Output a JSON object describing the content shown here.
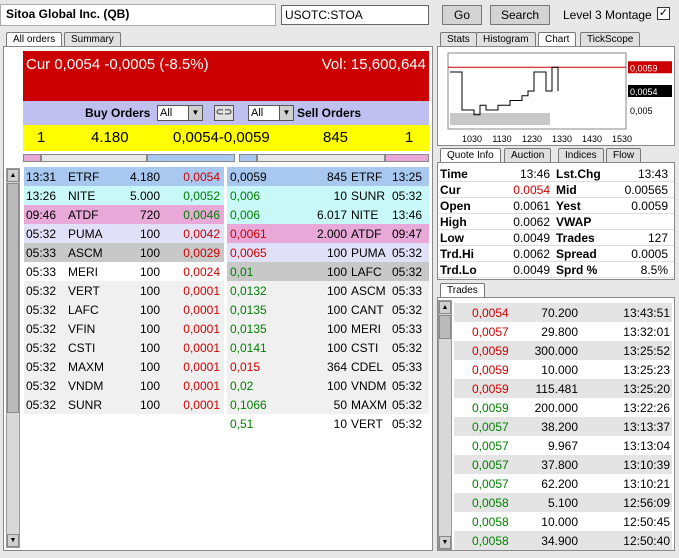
{
  "header": {
    "company": "Sitoa Global Inc. (QB)",
    "symbol": "USOTC:STOA",
    "go_label": "Go",
    "search_label": "Search",
    "level3_label": "Level 3 Montage",
    "level3_checked": "✓"
  },
  "left_tabs": [
    "All orders",
    "Summary"
  ],
  "right_tabs": [
    "Stats",
    "Histogram",
    "Chart",
    "TickScope"
  ],
  "quote_tabs": [
    "Quote Info",
    "Auction",
    "Indices",
    "Flow"
  ],
  "trades_tab": "Trades",
  "banner": {
    "cur": "Cur 0,0054 -0,0005 (-8.5%)",
    "vol": "Vol: 15,600,644"
  },
  "orders_header": {
    "buy_label": "Buy Orders",
    "sell_label": "Sell Orders",
    "buy_filter": "All",
    "sell_filter": "All"
  },
  "best": {
    "bid_count": "1",
    "bid_size": "4.180",
    "spread": "0,0054-0,0059",
    "ask_size": "845",
    "ask_count": "1"
  },
  "buy_orders": [
    {
      "time": "13:31",
      "mm": "ETRF",
      "size": "4.180",
      "price": "0,0054",
      "pc": "red",
      "bg": "#a8c8f0"
    },
    {
      "time": "13:26",
      "mm": "NITE",
      "size": "5.000",
      "price": "0,0052",
      "pc": "grn",
      "bg": "#c8f8f8"
    },
    {
      "time": "09:46",
      "mm": "ATDF",
      "size": "720",
      "price": "0,0046",
      "pc": "grn",
      "bg": "#e8a8d8"
    },
    {
      "time": "05:32",
      "mm": "PUMA",
      "size": "100",
      "price": "0,0042",
      "pc": "red",
      "bg": "#e0e0f8"
    },
    {
      "time": "05:33",
      "mm": "ASCM",
      "size": "100",
      "price": "0,0029",
      "pc": "red",
      "bg": "#c8c8c8"
    },
    {
      "time": "05:33",
      "mm": "MERI",
      "size": "100",
      "price": "0,0024",
      "pc": "red",
      "bg": "#ffffff"
    },
    {
      "time": "05:32",
      "mm": "VERT",
      "size": "100",
      "price": "0,0001",
      "pc": "red",
      "bg": "#f0f0f0"
    },
    {
      "time": "05:32",
      "mm": "LAFC",
      "size": "100",
      "price": "0,0001",
      "pc": "red",
      "bg": "#f0f0f0"
    },
    {
      "time": "05:32",
      "mm": "VFIN",
      "size": "100",
      "price": "0,0001",
      "pc": "red",
      "bg": "#f0f0f0"
    },
    {
      "time": "05:32",
      "mm": "CSTI",
      "size": "100",
      "price": "0,0001",
      "pc": "red",
      "bg": "#f0f0f0"
    },
    {
      "time": "05:32",
      "mm": "MAXM",
      "size": "100",
      "price": "0,0001",
      "pc": "red",
      "bg": "#f0f0f0"
    },
    {
      "time": "05:32",
      "mm": "VNDM",
      "size": "100",
      "price": "0,0001",
      "pc": "red",
      "bg": "#f0f0f0"
    },
    {
      "time": "05:32",
      "mm": "SUNR",
      "size": "100",
      "price": "0,0001",
      "pc": "red",
      "bg": "#f0f0f0"
    }
  ],
  "sell_orders": [
    {
      "price": "0,0059",
      "size": "845",
      "mm": "ETRF",
      "time": "13:25",
      "pc": "blk",
      "bg": "#a8c8f0"
    },
    {
      "price": "0,006",
      "size": "10",
      "mm": "SUNR",
      "time": "05:32",
      "pc": "grn",
      "bg": "#c8f8f8"
    },
    {
      "price": "0,006",
      "size": "6.017",
      "mm": "NITE",
      "time": "13:46",
      "pc": "grn",
      "bg": "#c8f8f8"
    },
    {
      "price": "0,0061",
      "size": "2.000",
      "mm": "ATDF",
      "time": "09:47",
      "pc": "red",
      "bg": "#e8a8d8"
    },
    {
      "price": "0,0065",
      "size": "100",
      "mm": "PUMA",
      "time": "05:32",
      "pc": "red",
      "bg": "#e0e0f8"
    },
    {
      "price": "0,01",
      "size": "100",
      "mm": "LAFC",
      "time": "05:32",
      "pc": "grn",
      "bg": "#c8c8c8"
    },
    {
      "price": "0,0132",
      "size": "100",
      "mm": "ASCM",
      "time": "05:33",
      "pc": "grn",
      "bg": "#f0f0f0"
    },
    {
      "price": "0,0135",
      "size": "100",
      "mm": "CANT",
      "time": "05:32",
      "pc": "grn",
      "bg": "#f0f0f0"
    },
    {
      "price": "0,0135",
      "size": "100",
      "mm": "MERI",
      "time": "05:33",
      "pc": "grn",
      "bg": "#f0f0f0"
    },
    {
      "price": "0,0141",
      "size": "100",
      "mm": "CSTI",
      "time": "05:32",
      "pc": "grn",
      "bg": "#f0f0f0"
    },
    {
      "price": "0,015",
      "size": "364",
      "mm": "CDEL",
      "time": "05:33",
      "pc": "red",
      "bg": "#f0f0f0"
    },
    {
      "price": "0,02",
      "size": "100",
      "mm": "VNDM",
      "time": "05:32",
      "pc": "grn",
      "bg": "#f0f0f0"
    },
    {
      "price": "0,1066",
      "size": "50",
      "mm": "MAXM",
      "time": "05:32",
      "pc": "grn",
      "bg": "#f0f0f0"
    },
    {
      "price": "0,51",
      "size": "10",
      "mm": "VERT",
      "time": "05:32",
      "pc": "grn",
      "bg": "#ffffff"
    }
  ],
  "chart": {
    "x_ticks": [
      "1030",
      "1130",
      "1230",
      "1330",
      "1430",
      "1530"
    ],
    "y_labels": [
      "0,0059",
      "0,0054",
      "0,005"
    ],
    "prices": [
      0.0058,
      0.0058,
      0.005,
      0.005,
      0.0049,
      0.0051,
      0.005,
      0.005,
      0.0051,
      0.0051,
      0.0052,
      0.0052,
      0.0053,
      0.0054,
      0.0058,
      0.0058,
      0.0054,
      0.0059,
      0.0054
    ],
    "colors": {
      "last": "#cc0000",
      "current": "#000000"
    }
  },
  "quote": [
    {
      "l1": "Time",
      "v1": "13:46",
      "l2": "Lst.Chg",
      "v2": "13:43",
      "c1": ""
    },
    {
      "l1": "Cur",
      "v1": "0.0054",
      "l2": "Mid",
      "v2": "0.00565",
      "c1": "red"
    },
    {
      "l1": "Open",
      "v1": "0.0061",
      "l2": "Yest",
      "v2": "0.0059",
      "c1": ""
    },
    {
      "l1": "High",
      "v1": "0.0062",
      "l2": "VWAP",
      "v2": "",
      "c1": ""
    },
    {
      "l1": "Low",
      "v1": "0.0049",
      "l2": "Trades",
      "v2": "127",
      "c1": ""
    },
    {
      "l1": "Trd.Hi",
      "v1": "0.0062",
      "l2": "Spread",
      "v2": "0.0005",
      "c1": ""
    },
    {
      "l1": "Trd.Lo",
      "v1": "0.0049",
      "l2": "Sprd %",
      "v2": "8.5%",
      "c1": ""
    }
  ],
  "trades": [
    {
      "price": "0,0054",
      "size": "70.200",
      "time": "13:43:51",
      "pc": "red"
    },
    {
      "price": "0,0057",
      "size": "29.800",
      "time": "13:32:01",
      "pc": "red"
    },
    {
      "price": "0,0059",
      "size": "300.000",
      "time": "13:25:52",
      "pc": "red"
    },
    {
      "price": "0,0059",
      "size": "10.000",
      "time": "13:25:23",
      "pc": "red"
    },
    {
      "price": "0,0059",
      "size": "115.481",
      "time": "13:25:20",
      "pc": "red"
    },
    {
      "price": "0,0059",
      "size": "200.000",
      "time": "13:22:26",
      "pc": "grn"
    },
    {
      "price": "0,0057",
      "size": "38.200",
      "time": "13:13:37",
      "pc": "grn"
    },
    {
      "price": "0,0057",
      "size": "9.967",
      "time": "13:13:04",
      "pc": "grn"
    },
    {
      "price": "0,0057",
      "size": "37.800",
      "time": "13:10:39",
      "pc": "grn"
    },
    {
      "price": "0,0057",
      "size": "62.200",
      "time": "13:10:21",
      "pc": "grn"
    },
    {
      "price": "0,0058",
      "size": "5.100",
      "time": "12:56:09",
      "pc": "grn"
    },
    {
      "price": "0,0058",
      "size": "10.000",
      "time": "12:50:45",
      "pc": "grn"
    },
    {
      "price": "0,0058",
      "size": "34.900",
      "time": "12:50:40",
      "pc": "grn"
    }
  ]
}
